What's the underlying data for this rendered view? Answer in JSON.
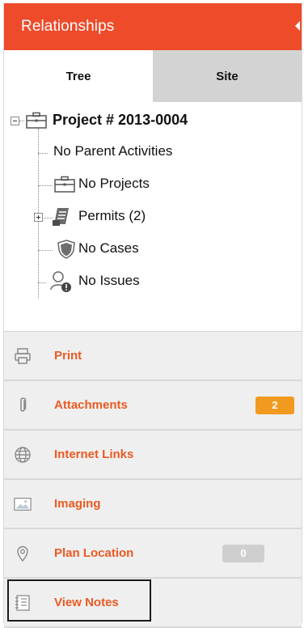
{
  "header": {
    "title": "Relationships"
  },
  "tabs": [
    {
      "label": "Tree",
      "active": true
    },
    {
      "label": "Site",
      "active": false
    }
  ],
  "tree": {
    "root": {
      "label": "Project # 2013-0004",
      "icon": "briefcase-icon"
    },
    "children": [
      {
        "label": "No Parent Activities",
        "icon": ""
      },
      {
        "label": "No Projects",
        "icon": "briefcase-icon"
      },
      {
        "label": "Permits (2)",
        "icon": "permit-document-icon"
      },
      {
        "label": "No Cases",
        "icon": "shield-icon"
      },
      {
        "label": "No Issues",
        "icon": "user-alert-icon"
      }
    ]
  },
  "menu": [
    {
      "label": "Print",
      "icon": "printer-icon"
    },
    {
      "label": "Attachments",
      "icon": "paperclip-icon",
      "badge": "2"
    },
    {
      "label": "Internet Links",
      "icon": "globe-icon"
    },
    {
      "label": "Imaging",
      "icon": "image-icon"
    },
    {
      "label": "Plan Location",
      "icon": "map-pin-icon",
      "badge": "0"
    },
    {
      "label": "View Notes",
      "icon": "notes-icon"
    }
  ],
  "colors": {
    "header": "#ee4b2b",
    "menu_label": "#ea5a22",
    "badge_orange": "#f29a1f",
    "badge_gray": "#cfcfcf"
  }
}
